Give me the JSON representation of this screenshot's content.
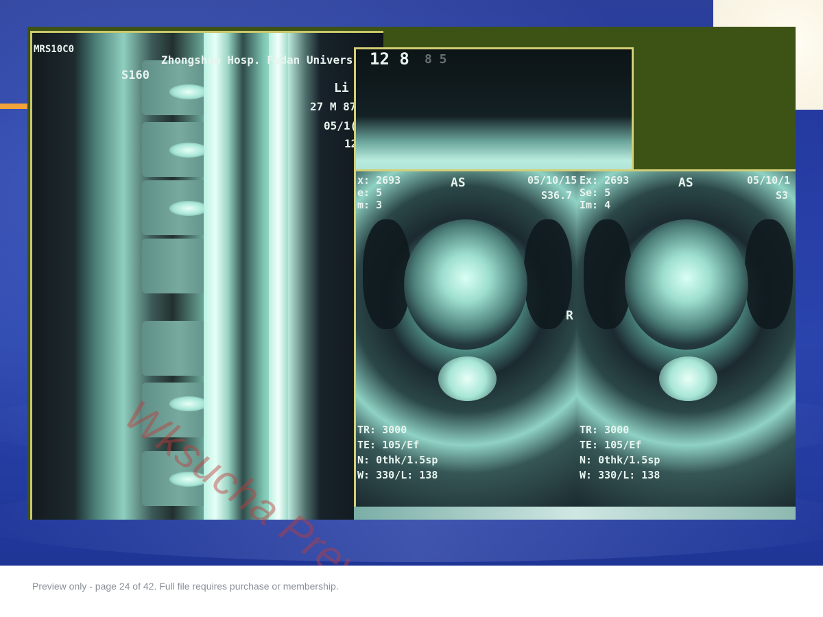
{
  "mri": {
    "sagittal": {
      "series_label": "MRS10C0",
      "slice_label": "S160",
      "hospital": "Zhongshan Hosp. Fudan Univers",
      "patient_name": "Li",
      "patient_info": "27 M 87",
      "date": "05/1(",
      "time": "12"
    },
    "axial_top": {
      "label": "12 8",
      "extra": "8 5"
    },
    "axial_left": {
      "ex": "x: 2693",
      "se": "e: 5",
      "im": "m: 3",
      "orientation": "AS",
      "date": "05/10/15",
      "slice": "S36.7",
      "side": "R",
      "tr": "TR: 3000",
      "te": "TE: 105/Ef",
      "nex": "N: 0thk/1.5sp",
      "w": "W: 330/L: 138"
    },
    "axial_right": {
      "ex": "Ex: 2693",
      "se": "Se: 5",
      "im": "Im: 4",
      "orientation": "AS",
      "date": "05/10/1",
      "slice": "S3",
      "tr": "TR: 3000",
      "te": "TE: 105/Ef",
      "nex": "N: 0thk/1.5sp",
      "w": "W: 330/L: 138"
    }
  },
  "watermark": "Wksucha Preview",
  "footer": {
    "text": "Preview only - page 24 of 42. Full file requires purchase or membership."
  },
  "colors": {
    "slide_background": "#2a44ad",
    "accent_orange": "#f2a33a",
    "frame_yellow": "#d4cf74",
    "photo_green": "#3d5316",
    "footer_text": "#8a8f99"
  }
}
